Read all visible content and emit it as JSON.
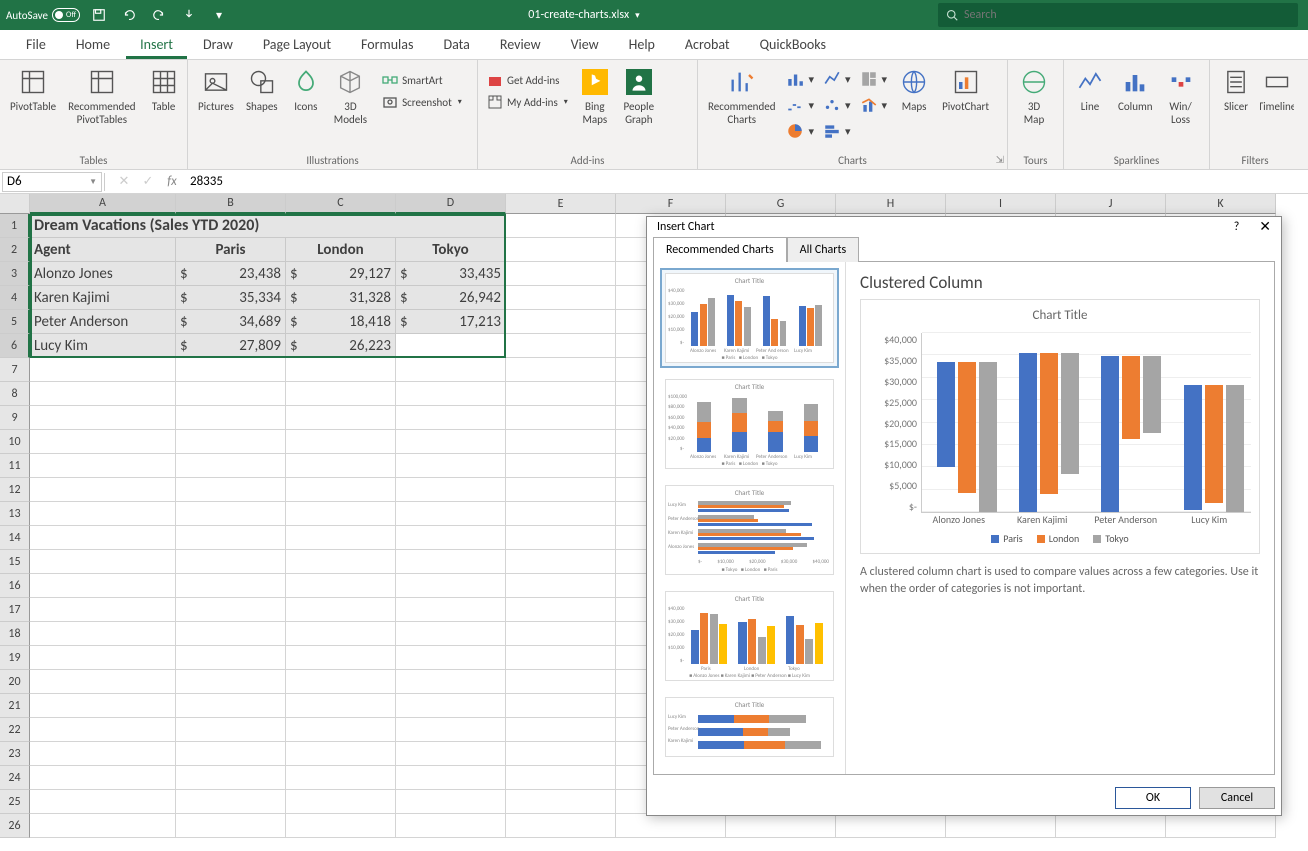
{
  "title_bar": {
    "autosave_label": "AutoSave",
    "autosave_state": "Off",
    "filename": "01-create-charts.xlsx",
    "search_placeholder": "Search"
  },
  "menu": [
    "File",
    "Home",
    "Insert",
    "Draw",
    "Page Layout",
    "Formulas",
    "Data",
    "Review",
    "View",
    "Help",
    "Acrobat",
    "QuickBooks"
  ],
  "menu_active": "Insert",
  "ribbon": {
    "tables": {
      "label": "Tables",
      "items": [
        "PivotTable",
        "Recommended\nPivotTables",
        "Table"
      ]
    },
    "illustrations": {
      "label": "Illustrations",
      "items": [
        "Pictures",
        "Shapes",
        "Icons",
        "3D\nModels"
      ],
      "smartart": "SmartArt",
      "screenshot": "Screenshot"
    },
    "addins": {
      "label": "Add-ins",
      "get": "Get Add-ins",
      "my": "My Add-ins",
      "bing": "Bing\nMaps",
      "people": "People\nGraph"
    },
    "charts": {
      "label": "Charts",
      "rec": "Recommended\nCharts",
      "maps": "Maps",
      "pivot": "PivotChart"
    },
    "tours": {
      "label": "Tours",
      "map3d": "3D\nMap"
    },
    "sparklines": {
      "label": "Sparklines",
      "items": [
        "Line",
        "Column",
        "Win/\nLoss"
      ]
    },
    "filters": {
      "label": "Filters",
      "items": [
        "Slicer",
        "Timeline"
      ]
    }
  },
  "formula_bar": {
    "name_box": "D6",
    "value": "28335"
  },
  "columns": [
    "A",
    "B",
    "C",
    "D",
    "E",
    "F",
    "G",
    "H",
    "I",
    "J",
    "K"
  ],
  "sheet": {
    "title": "Dream Vacations (Sales YTD 2020)",
    "headers": [
      "Agent",
      "Paris",
      "London",
      "Tokyo"
    ],
    "rows": [
      {
        "agent": "Alonzo Jones",
        "paris": "23,438",
        "london": "29,127",
        "tokyo": "33,435"
      },
      {
        "agent": "Karen Kajimi",
        "paris": "35,334",
        "london": "31,328",
        "tokyo": "26,942"
      },
      {
        "agent": "Peter Anderson",
        "paris": "34,689",
        "london": "18,418",
        "tokyo": "17,213"
      },
      {
        "agent": "Lucy Kim",
        "paris": "27,809",
        "london": "26,223",
        "tokyo": "28,335"
      }
    ]
  },
  "dialog": {
    "title": "Insert Chart",
    "tabs": [
      "Recommended Charts",
      "All Charts"
    ],
    "active_tab": "Recommended Charts",
    "preview_heading": "Clustered Column",
    "chart_title": "Chart Title",
    "desc": "A clustered column chart is used to compare values across a few categories. Use it when the order of categories is not important.",
    "ok": "OK",
    "cancel": "Cancel"
  },
  "chart_data": {
    "type": "bar",
    "title": "Chart Title",
    "xlabel": "",
    "ylabel": "",
    "ylim": [
      0,
      40000
    ],
    "y_ticks": [
      "$40,000",
      "$35,000",
      "$30,000",
      "$25,000",
      "$20,000",
      "$15,000",
      "$10,000",
      "$5,000",
      "$-"
    ],
    "categories": [
      "Alonzo Jones",
      "Karen Kajimi",
      "Peter Anderson",
      "Lucy Kim"
    ],
    "series": [
      {
        "name": "Paris",
        "color": "#4472C4",
        "values": [
          23438,
          35334,
          34689,
          27809
        ]
      },
      {
        "name": "London",
        "color": "#ED7D31",
        "values": [
          29127,
          31328,
          18418,
          26223
        ]
      },
      {
        "name": "Tokyo",
        "color": "#A5A5A5",
        "values": [
          33435,
          26942,
          17213,
          28335
        ]
      }
    ]
  }
}
